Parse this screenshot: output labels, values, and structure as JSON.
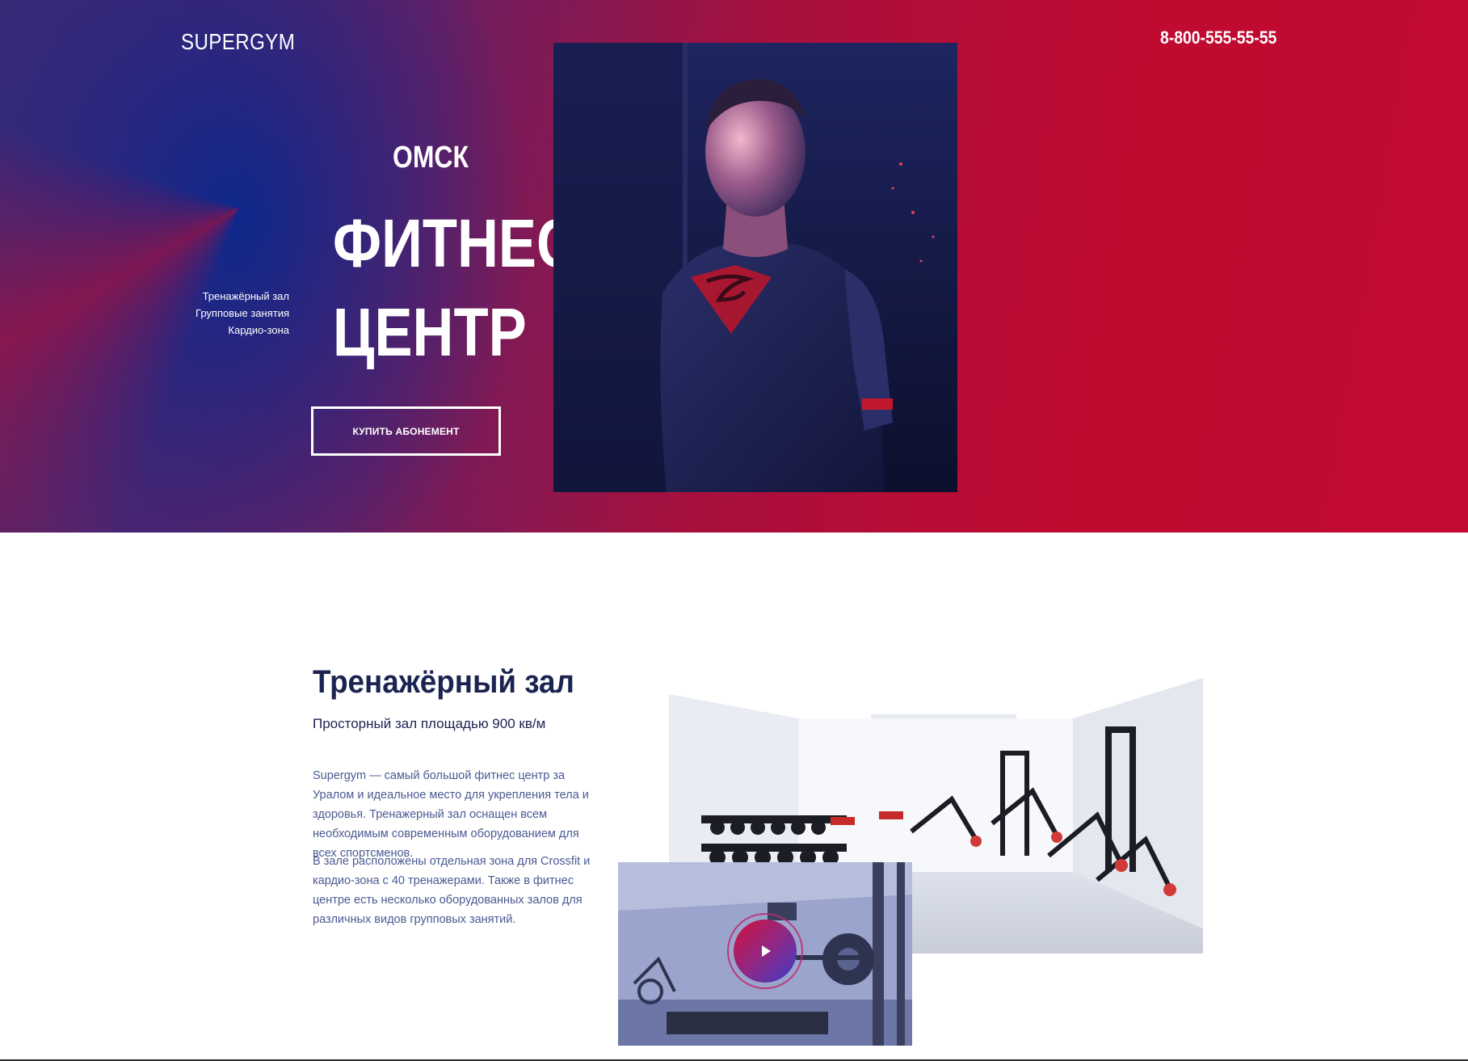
{
  "header": {
    "logo": "SUPERGYM",
    "phone": "8-800-555-55-55"
  },
  "hero": {
    "city": "ОМСК",
    "title_line1": "ФИТНЕС",
    "title_line2": "ЦЕНТР",
    "features": [
      "Тренажёрный зал",
      "Групповые занятия",
      "Кардио-зона"
    ],
    "cta_label": "КУПИТЬ АБОНЕМЕНТ"
  },
  "gym": {
    "title": "Тренажёрный зал",
    "subtitle": "Просторный зал площадью 900 кв/м",
    "paragraph1": "Supergym — самый большой фитнес центр за Уралом и идеальное место для укрепления тела и здоровья. Тренажерный зал оснащен всем необходимым современным оборудованием для всех спортсменов.",
    "paragraph2": "В зале расположены отдельная зона для Crossfit и кардио-зона с 40 тренажерами. Также в фитнес центре есть несколько оборудованных залов для различных видов групповых занятий."
  },
  "colors": {
    "hero_red": "#c20a32",
    "hero_blue": "#0a288c",
    "heading_navy": "#1b2450",
    "body_text": "#4a5a92"
  },
  "icons": {
    "play": "play-icon"
  }
}
